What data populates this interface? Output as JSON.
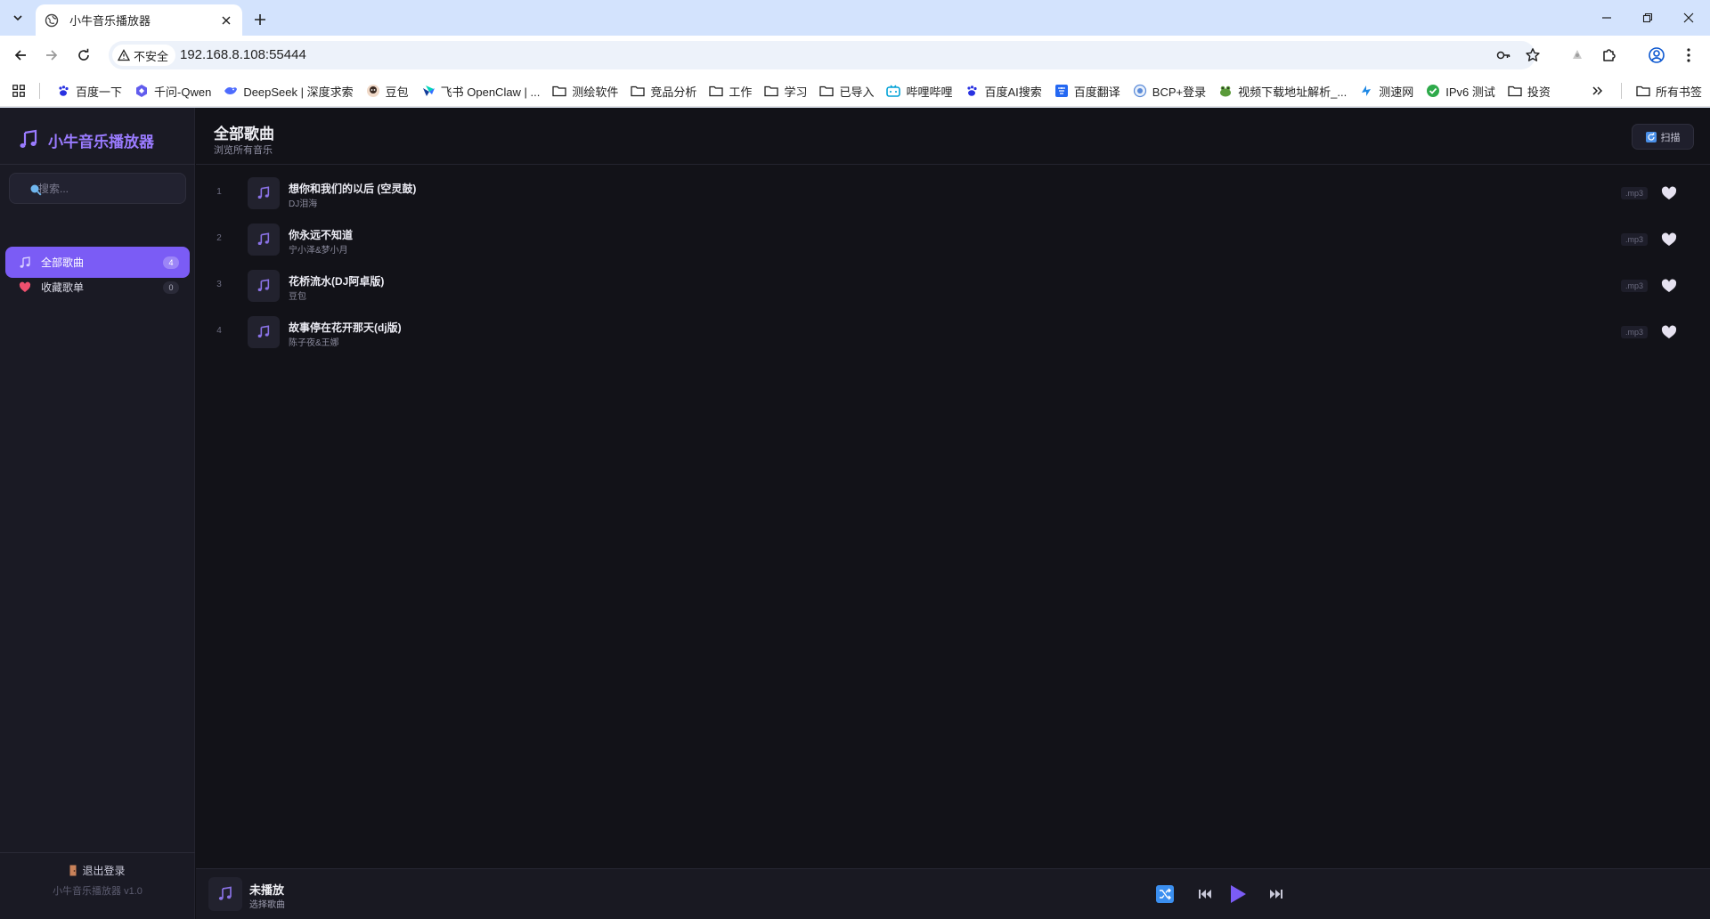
{
  "browser": {
    "tab_title": "小牛音乐播放器",
    "security_label": "不安全",
    "url": "192.168.8.108:55444",
    "bookmarks": [
      {
        "label": "百度一下",
        "icon": "baidu-icon"
      },
      {
        "label": "千问-Qwen",
        "icon": "qwen-icon"
      },
      {
        "label": "DeepSeek | 深度求索",
        "icon": "deepseek-icon"
      },
      {
        "label": "豆包",
        "icon": "doubao-icon"
      },
      {
        "label": "飞书 OpenClaw | ...",
        "icon": "feishu-icon"
      },
      {
        "label": "测绘软件",
        "icon": "folder-icon"
      },
      {
        "label": "竞品分析",
        "icon": "folder-icon"
      },
      {
        "label": "工作",
        "icon": "folder-icon"
      },
      {
        "label": "学习",
        "icon": "folder-icon"
      },
      {
        "label": "已导入",
        "icon": "folder-icon"
      },
      {
        "label": "哔哩哔哩",
        "icon": "bilibili-icon"
      },
      {
        "label": "百度AI搜索",
        "icon": "baidu-icon"
      },
      {
        "label": "百度翻译",
        "icon": "translate-icon"
      },
      {
        "label": "BCP+登录",
        "icon": "bcp-icon"
      },
      {
        "label": "视频下载地址解析_...",
        "icon": "frog-icon"
      },
      {
        "label": "测速网",
        "icon": "speedtest-icon"
      },
      {
        "label": "IPv6 测试",
        "icon": "check-icon"
      },
      {
        "label": "投资",
        "icon": "folder-icon"
      }
    ],
    "all_bookmarks": "所有书签"
  },
  "app": {
    "brand": "小牛音乐播放器",
    "accent": "#7b5cf5",
    "search_placeholder": "搜索...",
    "nav": [
      {
        "label": "全部歌曲",
        "count": "4",
        "icon": "music-list-icon",
        "active": true
      },
      {
        "label": "收藏歌单",
        "count": "0",
        "icon": "heart-icon",
        "active": false
      }
    ],
    "logout": "退出登录",
    "version": "小牛音乐播放器 v1.0",
    "page_title": "全部歌曲",
    "page_subtitle": "浏览所有音乐",
    "scan_label": "扫描",
    "songs": [
      {
        "index": "1",
        "title": "想你和我们的以后 (空灵鼓)",
        "artist": "DJ泪海",
        "format": ".mp3"
      },
      {
        "index": "2",
        "title": "你永远不知道",
        "artist": "宁小泽&梦小月",
        "format": ".mp3"
      },
      {
        "index": "3",
        "title": "花桥流水(DJ阿卓版)",
        "artist": "豆包",
        "format": ".mp3"
      },
      {
        "index": "4",
        "title": "故事停在花开那天(dj版)",
        "artist": "陈子夜&王娜",
        "format": ".mp3"
      }
    ],
    "player": {
      "title": "未播放",
      "subtitle": "选择歌曲"
    }
  }
}
